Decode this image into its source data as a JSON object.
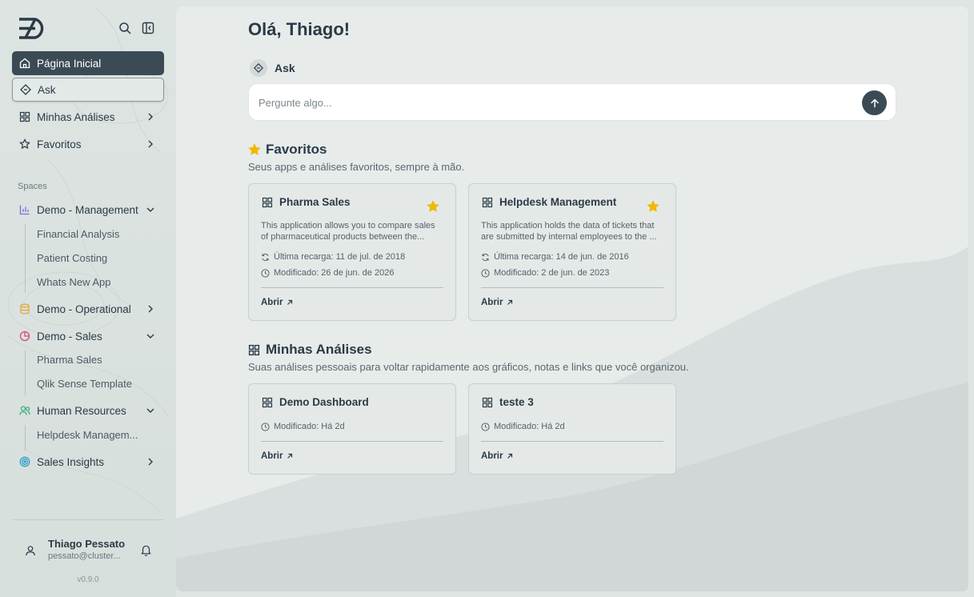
{
  "sidebar": {
    "nav": {
      "home": "Página Inicial",
      "ask": "Ask",
      "analyses": "Minhas Análises",
      "favorites": "Favoritos"
    },
    "spaces_label": "Spaces",
    "spaces": {
      "management": {
        "label": "Demo - Management",
        "children": [
          "Financial Analysis",
          "Patient Costing",
          "Whats New App"
        ]
      },
      "operational": {
        "label": "Demo - Operational"
      },
      "sales": {
        "label": "Demo - Sales",
        "children": [
          "Pharma Sales",
          "Qlik Sense Template"
        ]
      },
      "hr": {
        "label": "Human Resources",
        "children": [
          "Helpdesk Managem..."
        ]
      },
      "insights": {
        "label": "Sales Insights"
      }
    },
    "user": {
      "name": "Thiago Pessato",
      "email": "pessato@cluster..."
    },
    "version": "v0.9.0",
    "icons": [
      "logo",
      "search-icon",
      "collapse-sidebar-icon",
      "home-icon",
      "ask-icon",
      "grid-icon",
      "star-icon",
      "bar-chart-icon",
      "database-icon",
      "pie-chart-icon",
      "users-icon",
      "target-icon",
      "user-icon",
      "bell-icon"
    ]
  },
  "main": {
    "greeting": "Olá, Thiago!",
    "ask": {
      "label": "Ask",
      "placeholder": "Pergunte algo..."
    },
    "favorites": {
      "title": "Favoritos",
      "subtitle": "Seus apps e análises favoritos, sempre à mão.",
      "cards": [
        {
          "title": "Pharma Sales",
          "desc_1": "This application allows you to compare sales",
          "desc_2": "of pharmaceutical products between the...",
          "reload": "Última recarga: 11 de jul. de 2018",
          "modified": "Modificado: 26 de jun. de 2026",
          "open": "Abrir"
        },
        {
          "title": "Helpdesk Management",
          "desc_1": "This application holds the data of tickets that",
          "desc_2": "are submitted by internal employees to the ...",
          "reload": "Última recarga: 14 de jun. de 2016",
          "modified": "Modificado: 2 de jun. de 2023",
          "open": "Abrir"
        }
      ]
    },
    "analyses": {
      "title": "Minhas Análises",
      "subtitle": "Suas análises pessoais para voltar rapidamente aos gráficos, notas e links que você organizou.",
      "cards": [
        {
          "title": "Demo Dashboard",
          "modified": "Modificado: Há 2d",
          "open": "Abrir"
        },
        {
          "title": "teste 3",
          "modified": "Modificado: Há 2d",
          "open": "Abrir"
        }
      ]
    }
  },
  "colors": {
    "primary": "#3a4b56",
    "star": "#f2b705",
    "management": "#7b6fd6",
    "operational": "#e2a93b",
    "sales": "#d9477e",
    "hr": "#3fae7a",
    "insights": "#2b9ec4"
  }
}
